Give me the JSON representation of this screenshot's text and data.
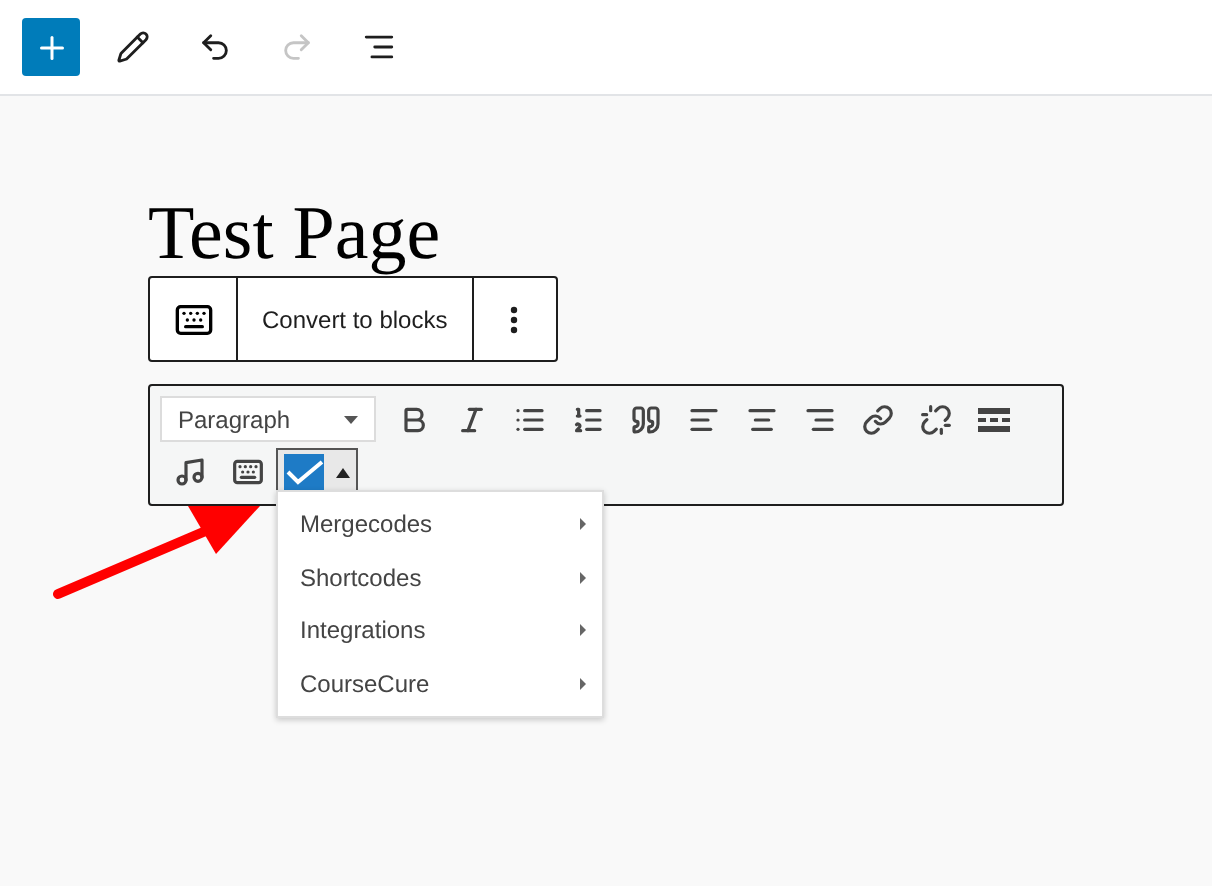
{
  "top_toolbar": [
    {
      "kind": "add",
      "disabled": false
    },
    {
      "kind": "edit",
      "disabled": false
    },
    {
      "kind": "undo",
      "disabled": false
    },
    {
      "kind": "redo",
      "disabled": true
    },
    {
      "kind": "outline",
      "disabled": false
    }
  ],
  "page_title": "Test Page",
  "block_toolbar": {
    "convert_label": "Convert to blocks"
  },
  "classic_toolbar": {
    "format_select": "Paragraph",
    "buttons": [
      {
        "kind": "bold"
      },
      {
        "kind": "italic"
      },
      {
        "kind": "bullets"
      },
      {
        "kind": "numbers"
      },
      {
        "kind": "quote"
      },
      {
        "kind": "align-left"
      },
      {
        "kind": "align-center"
      },
      {
        "kind": "align-right"
      },
      {
        "kind": "link"
      },
      {
        "kind": "unlink"
      },
      {
        "kind": "more"
      },
      {
        "kind": "media"
      },
      {
        "kind": "keyboard"
      }
    ],
    "split_button": {
      "expanded": true
    }
  },
  "menu": [
    {
      "label": "Mergecodes"
    },
    {
      "label": "Shortcodes"
    },
    {
      "label": "Integrations"
    },
    {
      "label": "CourseCure"
    }
  ]
}
